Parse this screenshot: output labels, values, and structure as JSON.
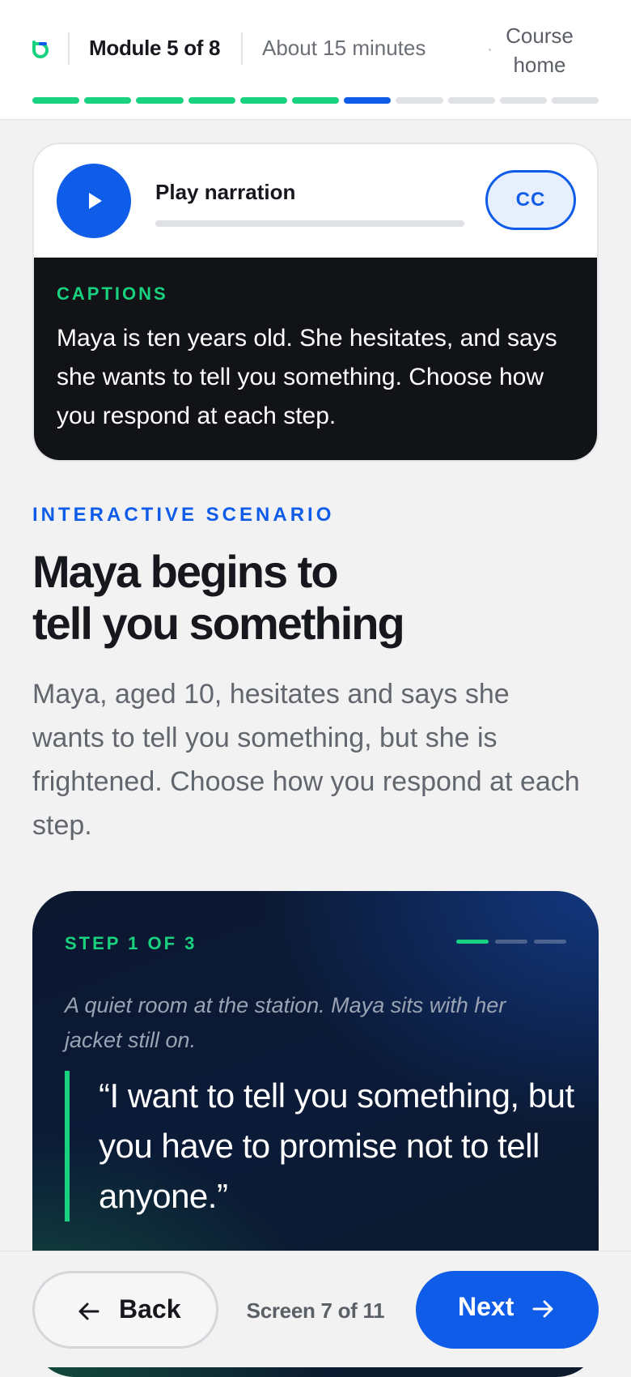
{
  "header": {
    "logo_icon": "brand-logo-icon",
    "module": "Module 5 of 8",
    "duration": "About 15 minutes",
    "course_home": "Course home",
    "progress": {
      "total_segments": 11,
      "completed_segments": 6,
      "current_segment": 7,
      "colors": {
        "done": "#19d27f",
        "current": "#0f5ce8",
        "upcoming": "#dfe1e5"
      }
    }
  },
  "narration": {
    "play_label": "Play narration",
    "play_icon": "play-icon",
    "playback_progress": 0,
    "cc_label": "CC",
    "captions_heading": "CAPTIONS",
    "captions_text": "Maya is ten years old. She hesitates, and says she wants to tell you something. Choose how you respond at each step."
  },
  "scenario": {
    "eyebrow": "INTERACTIVE SCENARIO",
    "title_line1": "Maya begins to",
    "title_line2": "tell you something",
    "description": "Maya, aged 10, hesitates and says she wants to tell you something, but she is frightened. Choose how you respond at each step.",
    "step": {
      "label": "STEP 1 OF 3",
      "current": 1,
      "total": 3,
      "setting": "A quiet room at the station. Maya sits with her jacket still on.",
      "quote": "“I want to tell you something, but you have to promise not to tell anyone.”"
    }
  },
  "footer": {
    "back_label": "Back",
    "back_icon": "arrow-left-icon",
    "screen_count": "Screen 7 of 11",
    "next_label": "Next",
    "next_icon": "arrow-right-icon"
  },
  "colors": {
    "accent": "#0f5ce8",
    "success": "#19d27f",
    "dark_panel": "#111317"
  }
}
